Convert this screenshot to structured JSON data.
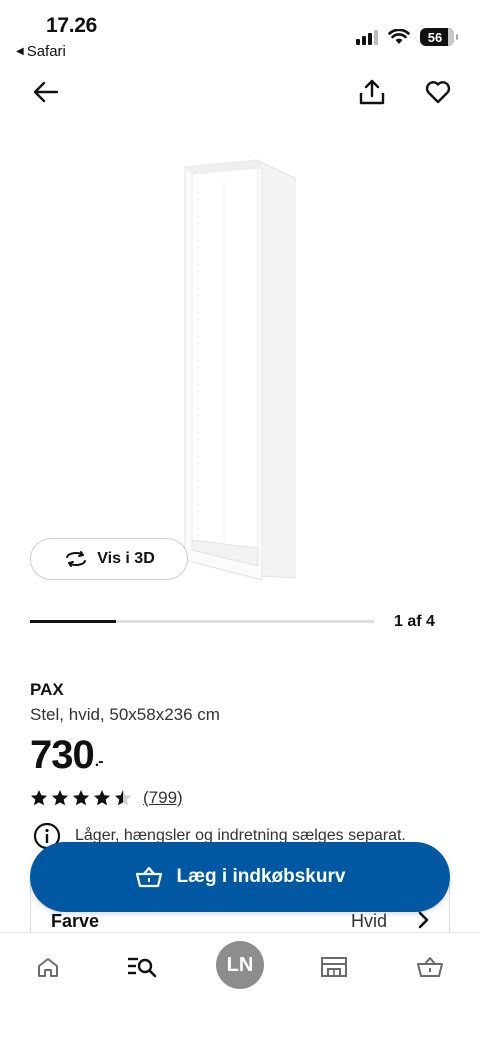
{
  "status": {
    "time": "17.26",
    "back_app": "Safari",
    "battery": "56"
  },
  "topbar": {
    "back": "arrow-left-icon",
    "share": "share-icon",
    "favourite": "heart-icon"
  },
  "gallery": {
    "view_3d_label": "Vis i 3D",
    "position_label": "1 af 4",
    "progress": 0.25
  },
  "product": {
    "name": "PAX",
    "description": "Stel, hvid, 50x58x236 cm",
    "price": "730",
    "price_suffix": ".-",
    "rating": 4.5,
    "review_count": "(799)",
    "notice": "Låger, hængsler og indretning sælges separat."
  },
  "colour": {
    "label": "Farve",
    "value": "Hvid"
  },
  "cart_button": {
    "label": "Læg i indkøbskurv"
  },
  "nav": {
    "profile_initials": "LN"
  },
  "colors": {
    "accent": "#0058a3",
    "avatar": "#8d8d8d"
  }
}
